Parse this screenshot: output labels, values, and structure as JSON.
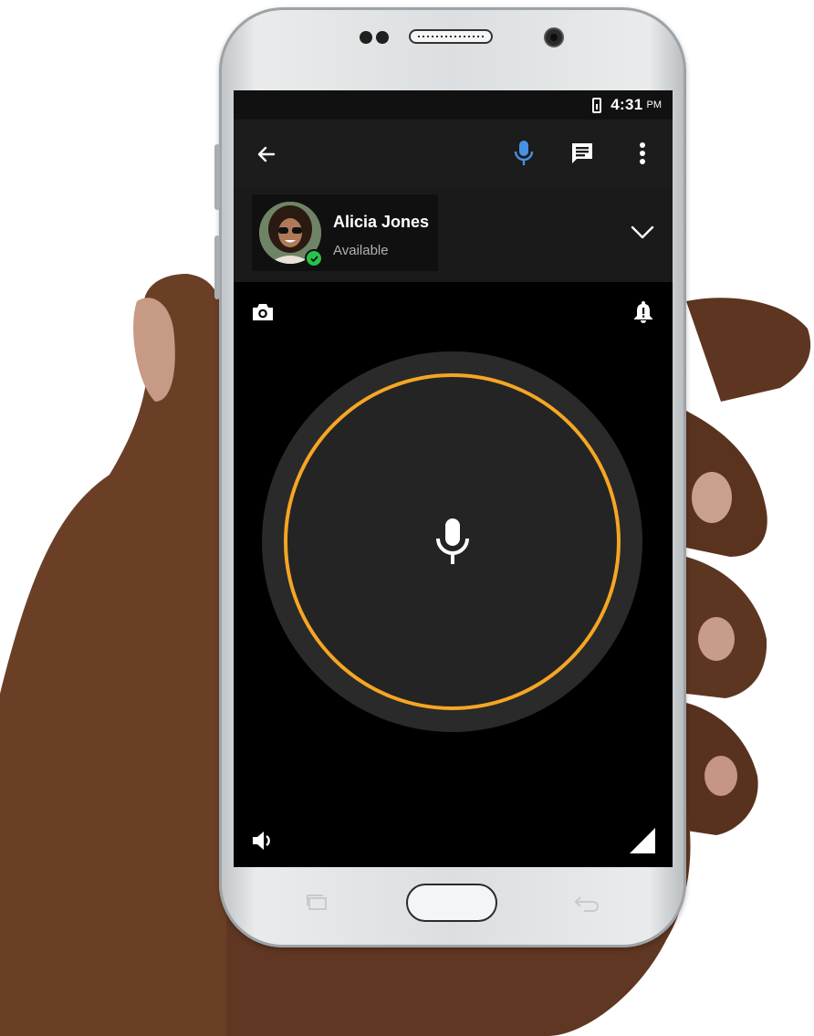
{
  "status_bar": {
    "time": "4:31",
    "ampm": "PM"
  },
  "app_bar": {
    "back_icon": "arrow-left-icon",
    "mic_icon": "microphone-icon",
    "chat_icon": "chat-icon",
    "menu_icon": "more-vert-icon"
  },
  "contact": {
    "name": "Alicia Jones",
    "status": "Available",
    "presence_color": "#27c24c",
    "expand_icon": "chevron-down-icon"
  },
  "controls": {
    "camera_icon": "camera-icon",
    "alert_icon": "alert-bell-icon",
    "ptt_icon": "microphone-icon",
    "ptt_ring_color": "#f5a623",
    "speaker_icon": "speaker-icon",
    "signal_icon": "signal-icon"
  },
  "nav": {
    "recents_icon": "recents-icon",
    "home_icon": "home-button",
    "back_icon": "back-icon"
  },
  "colors": {
    "accent_mic": "#4a90e2",
    "ring": "#f5a623"
  }
}
